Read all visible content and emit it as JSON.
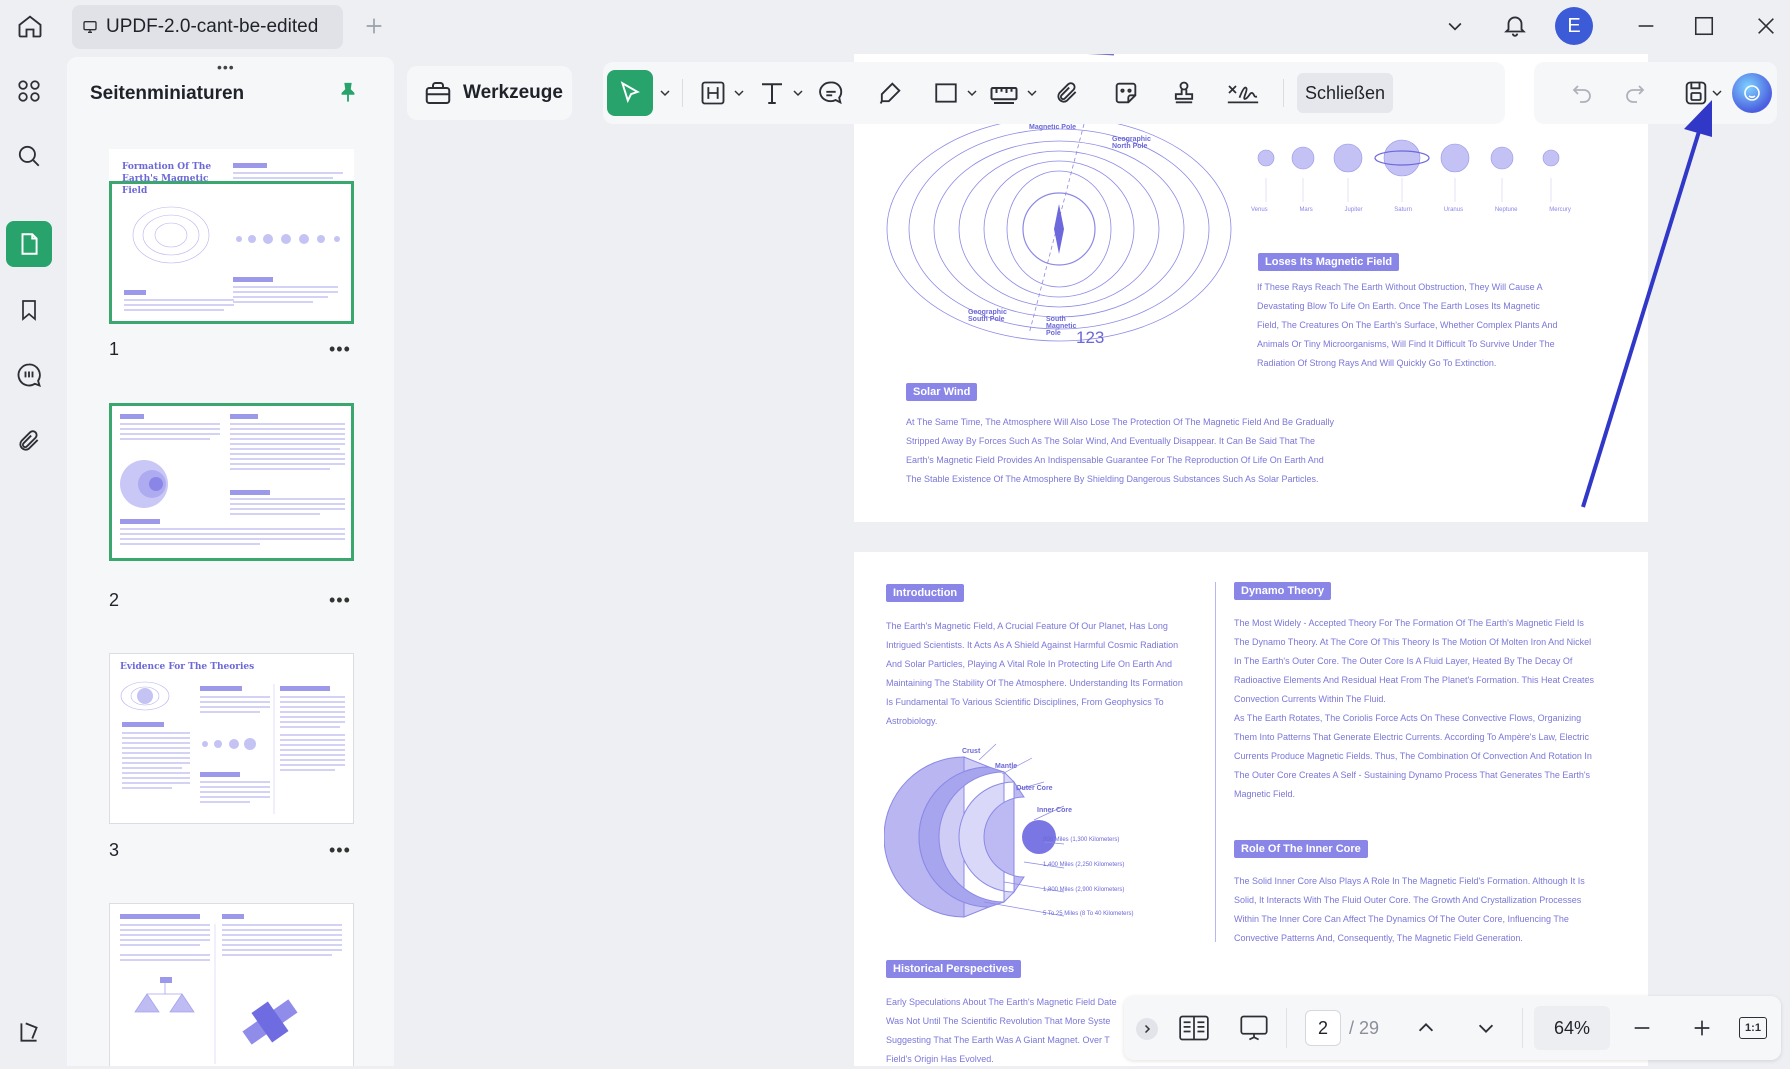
{
  "tab": {
    "title": "UPDF-2.0-cant-be-edited"
  },
  "avatar": {
    "initial": "E"
  },
  "thumbnail_panel": {
    "title": "Seitenminiaturen",
    "pages": [
      {
        "number": "1",
        "more": "•••",
        "heading": "Formation Of The Earth's Magnetic Field"
      },
      {
        "number": "2",
        "more": "•••"
      },
      {
        "number": "3",
        "more": "•••",
        "heading": "Evidence For The Theories"
      },
      {
        "number": "",
        "more": ""
      }
    ]
  },
  "toolbar": {
    "tools_label": "Werkzeuge",
    "close_label": "Schließen"
  },
  "page_top": {
    "diagram_labels": {
      "magnetic_pole": "Magnetic Pole",
      "geo_north": "Geographic North Pole",
      "geo_south": "Geographic South Pole",
      "south_magnetic": "South Magnetic Pole",
      "annotation": "123"
    },
    "planets": [
      "Venus",
      "Mars",
      "Jupiter",
      "Saturn",
      "Uranus",
      "Neptune",
      "Mercury"
    ],
    "loses_title": "Loses Its Magnetic Field",
    "loses_lines": [
      "If These Rays Reach The Earth Without Obstruction, They Will Cause A",
      "Devastating Blow To Life On Earth. Once The Earth Loses Its Magnetic",
      "Field, The Creatures On The Earth's Surface, Whether Complex Plants And",
      "Animals Or Tiny Microorganisms, Will Find It Difficult To Survive Under The",
      "Radiation Of Strong Rays And Will Quickly Go To Extinction."
    ],
    "solar_title": "Solar Wind",
    "solar_lines": [
      "At The Same Time, The Atmosphere Will Also Lose The Protection Of The Magnetic Field And Be Gradually",
      "Stripped Away By Forces Such As The Solar Wind, And Eventually Disappear. It Can Be Said That The",
      "Earth's Magnetic Field Provides An Indispensable Guarantee For The Reproduction Of Life On Earth And",
      "The Stable Existence Of The Atmosphere By Shielding Dangerous Substances Such As Solar Particles."
    ]
  },
  "page_bottom": {
    "intro_title": "Introduction",
    "intro_lines": [
      "The Earth's Magnetic Field, A Crucial Feature Of Our Planet, Has Long",
      "Intrigued Scientists. It Acts As A Shield Against Harmful Cosmic Radiation",
      "And Solar Particles, Playing A Vital Role In Protecting Life On Earth And",
      "Maintaining The Stability Of The Atmosphere. Understanding Its Formation",
      "Is Fundamental To Various Scientific Disciplines, From Geophysics To",
      "Astrobiology."
    ],
    "layers": {
      "crust": "Crust",
      "mantle": "Mantle",
      "outer": "Outer Core",
      "inner": "Inner Core",
      "d1": "800 Miles (1,300 Kilometers)",
      "d2": "1,400 Miles (2,250 Kilometers)",
      "d3": "1,800 Miles (2,900 Kilometers)",
      "d4": "5 To 25 Miles (8 To 40 Kilometers)"
    },
    "historical_title": "Historical Perspectives",
    "historical_lines": [
      "Early Speculations About The Earth's Magnetic Field Date",
      "Was Not Until The Scientific Revolution That More Syste",
      "Suggesting That The Earth Was A Giant Magnet. Over T",
      "Field's Origin Has Evolved."
    ],
    "dynamo_title": "Dynamo Theory",
    "dynamo_lines": [
      "The Most Widely - Accepted Theory For The Formation Of The Earth's Magnetic Field Is",
      "The Dynamo Theory. At The Core Of This Theory Is The Motion Of Molten Iron And Nickel",
      "In The Earth's Outer Core. The Outer Core Is A Fluid Layer, Heated By The Decay Of",
      "Radioactive Elements And Residual Heat From The Planet's Formation. This Heat Creates",
      "Convection Currents Within The Fluid.",
      "As The Earth Rotates, The Coriolis Force Acts On These Convective Flows, Organizing",
      "Them Into Patterns That Generate Electric Currents. According To Ampère's Law, Electric",
      "Currents Produce Magnetic Fields. Thus, The Combination Of Convection And Rotation In",
      "The Outer Core Creates A Self - Sustaining Dynamo Process That Generates The Earth's",
      "Magnetic Field."
    ],
    "inner_title": "Role Of The Inner Core",
    "inner_lines": [
      "The Solid Inner Core Also Plays A Role In The Magnetic Field's Formation. Although It Is",
      "Solid, It Interacts With The Fluid Outer Core. The Growth And Crystallization Processes",
      "Within The Inner Core Can Affect The Dynamics Of The Outer Core, Influencing The",
      "Convective Patterns And, Consequently, The Magnetic Field Generation."
    ]
  },
  "navigation": {
    "current_page": "2",
    "total": "/ 29",
    "zoom": "64%",
    "fit_label": "1:1"
  },
  "colors": {
    "accent": "#27a36b",
    "doc_purple": "#7b77d8",
    "arrow": "#3138c8"
  }
}
